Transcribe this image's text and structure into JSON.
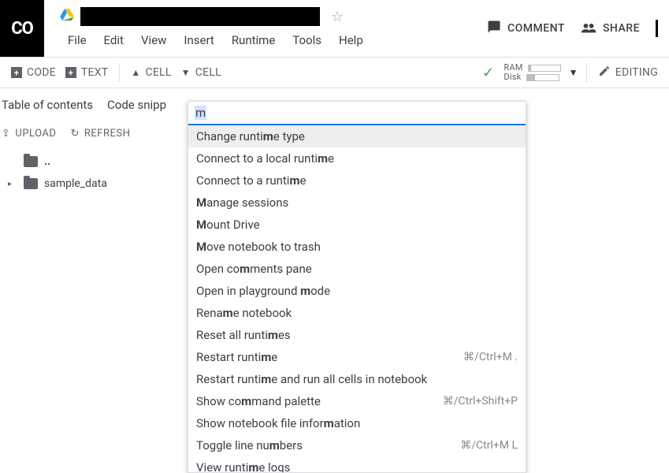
{
  "logo": "CO",
  "menus": [
    "File",
    "Edit",
    "View",
    "Insert",
    "Runtime",
    "Tools",
    "Help"
  ],
  "header": {
    "comment": "COMMENT",
    "share": "SHARE"
  },
  "toolbar": {
    "code": "CODE",
    "text": "TEXT",
    "cell_up": "CELL",
    "cell_down": "CELL",
    "ram": "RAM",
    "disk": "Disk",
    "editing": "EDITING"
  },
  "side": {
    "tab1": "Table of contents",
    "tab2": "Code snipp",
    "upload": "UPLOAD",
    "refresh": "REFRESH",
    "parent": "..",
    "folder": "sample_data"
  },
  "palette": {
    "query": "m",
    "items": [
      {
        "label": "Change runti<b>m</b>e type",
        "sc": ""
      },
      {
        "label": "Connect to a local runti<b>m</b>e",
        "sc": ""
      },
      {
        "label": "Connect to a runti<b>m</b>e",
        "sc": ""
      },
      {
        "label": "<b>M</b>anage sessions",
        "sc": ""
      },
      {
        "label": "<b>M</b>ount Drive",
        "sc": ""
      },
      {
        "label": "<b>M</b>ove notebook to trash",
        "sc": ""
      },
      {
        "label": "Open co<b>m</b>ments pane",
        "sc": ""
      },
      {
        "label": "Open in playground <b>m</b>ode",
        "sc": ""
      },
      {
        "label": "Rena<b>m</b>e notebook",
        "sc": ""
      },
      {
        "label": "Reset all runti<b>m</b>es",
        "sc": ""
      },
      {
        "label": "Restart runti<b>m</b>e",
        "sc": "⌘/Ctrl+M ."
      },
      {
        "label": "Restart runti<b>m</b>e and run all cells in notebook",
        "sc": ""
      },
      {
        "label": "Show co<b>m</b>mand palette",
        "sc": "⌘/Ctrl+Shift+P"
      },
      {
        "label": "Show notebook file infor<b>m</b>ation",
        "sc": ""
      },
      {
        "label": "Toggle line nu<b>m</b>bers",
        "sc": "⌘/Ctrl+M L"
      },
      {
        "label": "View runti<b>m</b>e logs",
        "sc": ""
      }
    ]
  }
}
